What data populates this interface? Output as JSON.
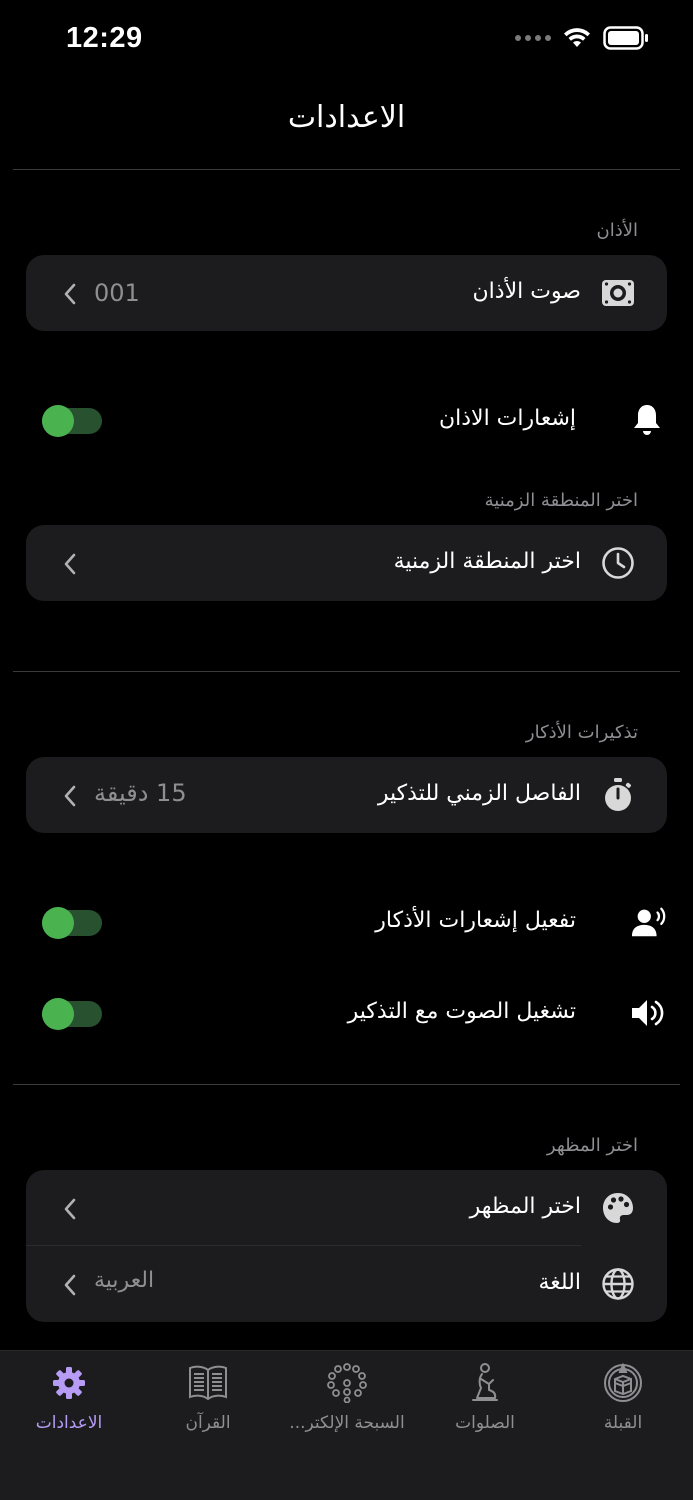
{
  "status_bar": {
    "time": "12:29"
  },
  "page": {
    "title": "الاعدادات"
  },
  "sections": {
    "adhan": {
      "header": "الأذان",
      "sound_row": {
        "label": "صوت الأذان",
        "value": "001",
        "icon": "speaker-icon"
      },
      "notifications_row": {
        "label": "إشعارات الاذان",
        "icon": "bell-icon",
        "enabled": true
      }
    },
    "timezone": {
      "header": "اختر المنطقة الزمنية",
      "row": {
        "label": "اختر المنطقة الزمنية",
        "icon": "clock-icon"
      }
    },
    "azkar": {
      "header": "تذكيرات الأذكار",
      "interval_row": {
        "label": "الفاصل الزمني للتذكير",
        "value": "15 دقيقة",
        "icon": "stopwatch-icon"
      },
      "enable_row": {
        "label": "تفعيل إشعارات الأذكار",
        "icon": "speaking-person-icon",
        "enabled": true
      },
      "sound_row": {
        "label": "تشغيل الصوت مع التذكير",
        "icon": "volume-icon",
        "enabled": true
      }
    },
    "appearance": {
      "header": "اختر المظهر",
      "theme_row": {
        "label": "اختر المظهر",
        "icon": "palette-icon"
      },
      "language_row": {
        "label": "اللغة",
        "value": "العربية",
        "icon": "globe-icon"
      }
    }
  },
  "tabs": [
    {
      "label": "الاعدادات",
      "icon": "gear-icon",
      "active": true
    },
    {
      "label": "القرآن",
      "icon": "quran-book-icon",
      "active": false
    },
    {
      "label": "السبحة الإلكتر...",
      "icon": "prayer-beads-icon",
      "active": false
    },
    {
      "label": "الصلوات",
      "icon": "praying-person-icon",
      "active": false
    },
    {
      "label": "القبلة",
      "icon": "qibla-kaaba-icon",
      "active": false
    }
  ],
  "colors": {
    "background": "#000000",
    "card": "#1c1c1e",
    "toggle_on": "#4ab34f",
    "tab_active": "#b69cf5",
    "secondary_text": "#8e8e93"
  }
}
